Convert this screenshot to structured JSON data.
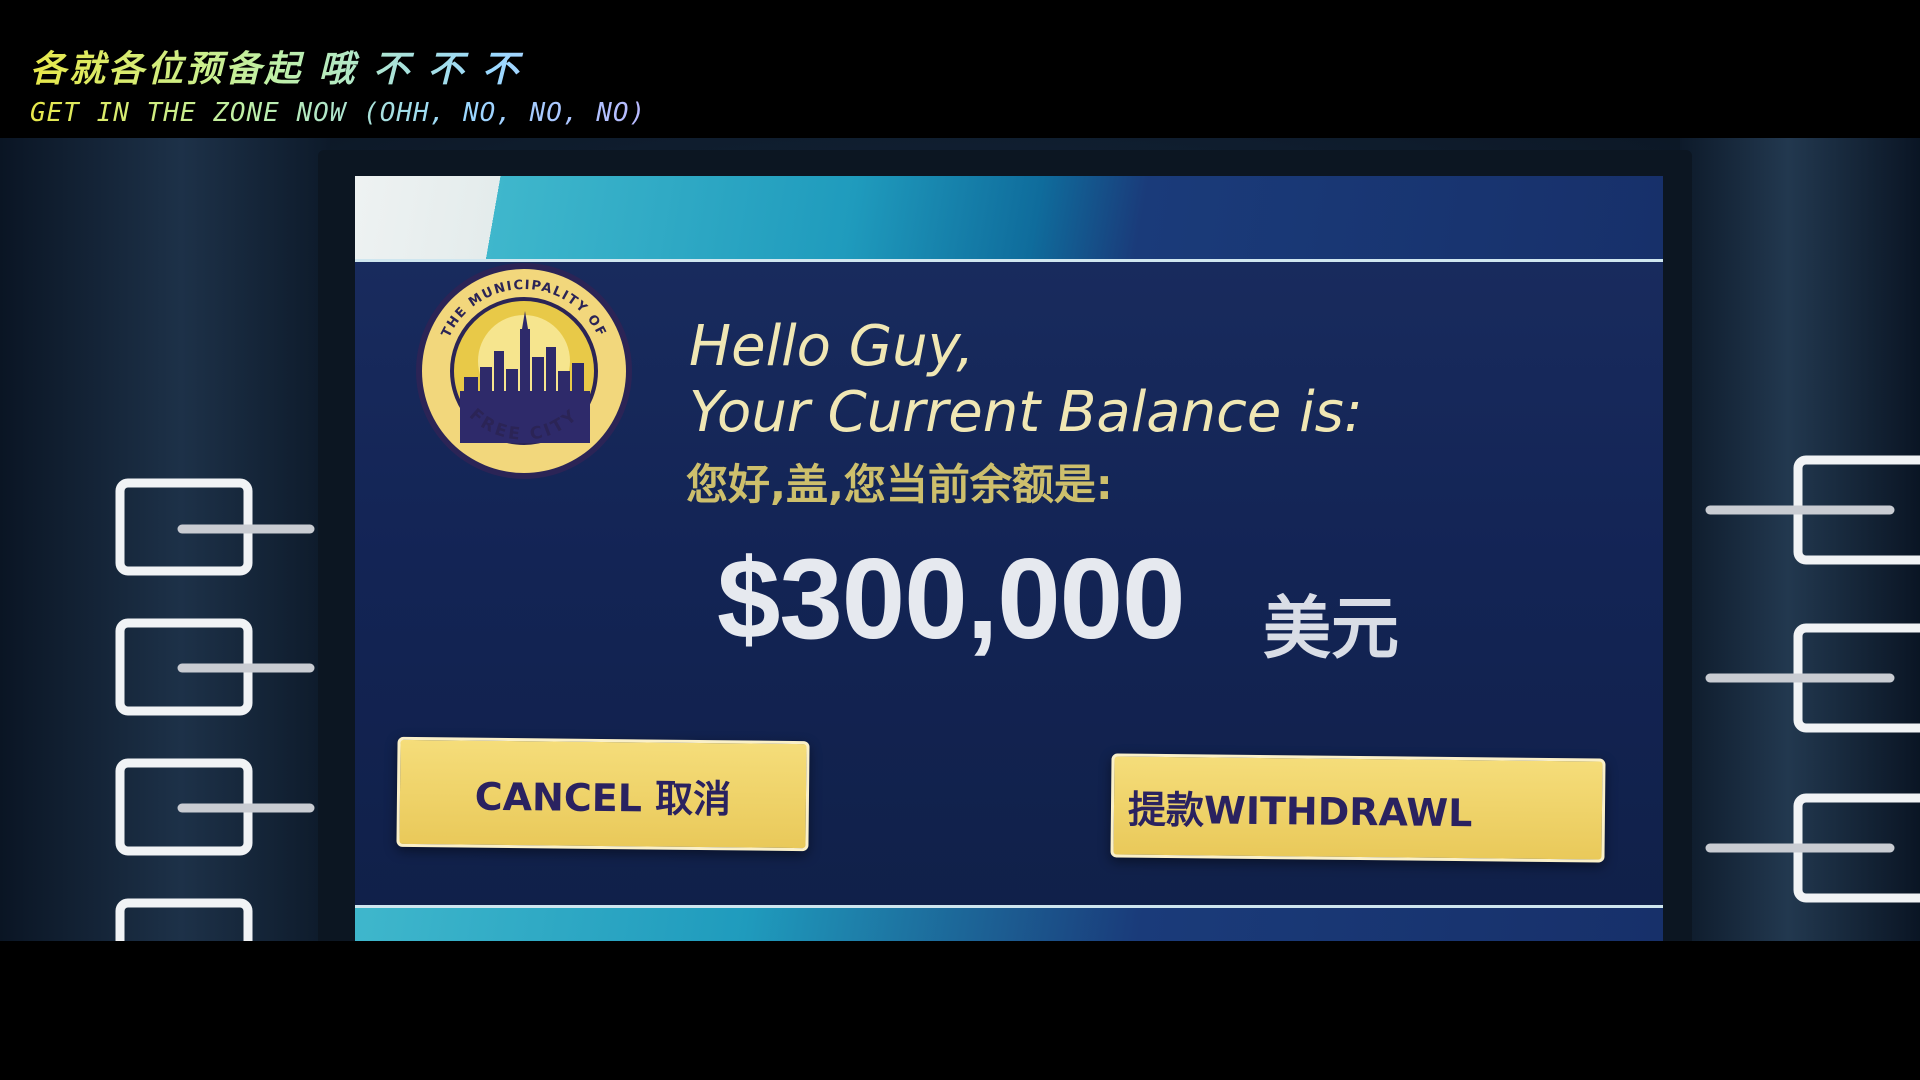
{
  "subtitles": {
    "chinese": "各就各位预备起 哦 不 不 不",
    "english": "GET IN THE ZONE NOW (OHH, NO, NO, NO)"
  },
  "logo": {
    "ring_text": "THE MUNICIPALITY OF",
    "bottom_text": "FREE CITY",
    "icon": "city-skyline-icon"
  },
  "screen": {
    "greeting_line1": "Hello Guy,",
    "greeting_line2": "Your Current Balance is:",
    "greeting_cn": "您好,盖,您当前余额是:",
    "balance": "$300,000",
    "currency_cn": "美元"
  },
  "buttons": {
    "cancel_label": "CANCEL 取消",
    "withdraw_label": "提款WITHDRAWL"
  },
  "colors": {
    "screen_bg": "#132455",
    "accent_teal": "#1f9bbd",
    "button_gold": "#f0d46a",
    "button_text": "#2a2260",
    "greeting_text": "#f0e7b4"
  }
}
